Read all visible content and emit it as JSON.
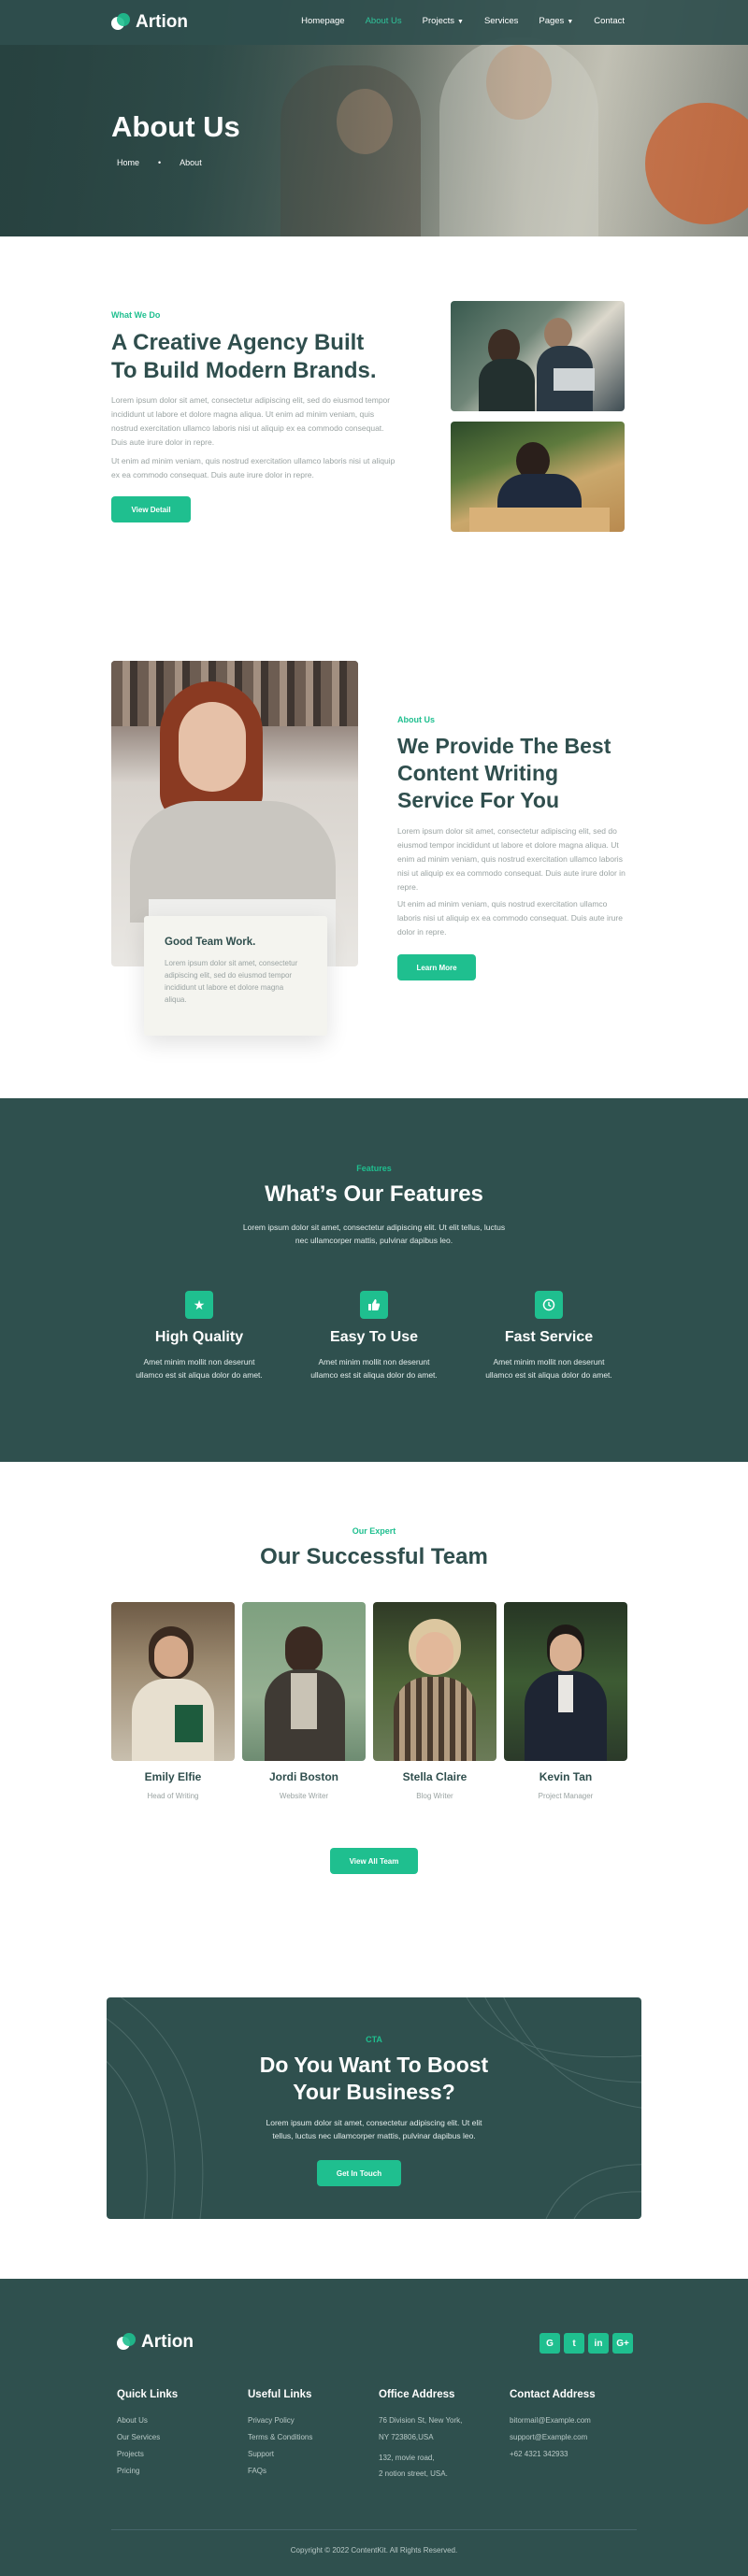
{
  "brand": {
    "name": "Artion"
  },
  "nav": {
    "items": [
      {
        "label": "Homepage"
      },
      {
        "label": "About Us"
      },
      {
        "label": "Projects"
      },
      {
        "label": "Services"
      },
      {
        "label": "Pages"
      },
      {
        "label": "Contact"
      }
    ]
  },
  "hero": {
    "title": "About Us",
    "crumb_home": "Home",
    "crumb_sep": "•",
    "crumb_current": "About"
  },
  "whatwedo": {
    "eyebrow": "What We Do",
    "title_line1": "A Creative Agency Built",
    "title_line2": "To Build Modern Brands.",
    "para1": "Lorem ipsum dolor sit amet, consectetur adipiscing elit, sed do eiusmod tempor incididunt ut labore et dolore magna aliqua. Ut enim ad minim veniam, quis nostrud exercitation ullamco laboris nisi ut aliquip ex ea commodo consequat. Duis aute irure dolor in repre.",
    "para2": "Ut enim ad minim veniam, quis nostrud exercitation ullamco laboris nisi ut aliquip ex ea commodo consequat. Duis aute irure dolor in repre.",
    "button": "View Detail"
  },
  "aboutus": {
    "eyebrow": "About Us",
    "title_line1": "We Provide The Best",
    "title_line2": "Content Writing",
    "title_line3": "Service For You",
    "para1": "Lorem ipsum dolor sit amet, consectetur adipiscing elit, sed do eiusmod tempor incididunt ut labore et dolore magna aliqua. Ut enim ad minim veniam, quis nostrud exercitation ullamco laboris nisi ut aliquip ex ea commodo consequat. Duis aute irure dolor in repre.",
    "para2": "Ut enim ad minim veniam, quis nostrud exercitation ullamco laboris nisi ut aliquip ex ea commodo consequat. Duis aute irure dolor in repre.",
    "button": "Learn More",
    "card_title": "Good Team Work.",
    "card_text": "Lorem ipsum dolor sit amet, consectetur adipiscing elit, sed do eiusmod tempor incididunt ut labore et dolore magna aliqua."
  },
  "features": {
    "eyebrow": "Features",
    "title": "What’s Our Features",
    "subtitle_line1": "Lorem ipsum dolor sit amet, consectetur adipiscing elit. Ut elit tellus, luctus",
    "subtitle_line2": "nec ullamcorper mattis, pulvinar dapibus leo.",
    "items": [
      {
        "icon": "star-icon",
        "title": "High Quality",
        "line1": "Amet minim mollit non deserunt",
        "line2": "ullamco est sit aliqua dolor do amet."
      },
      {
        "icon": "thumbs-up-icon",
        "title": "Easy To Use",
        "line1": "Amet minim mollit non deserunt",
        "line2": "ullamco est sit aliqua dolor do amet."
      },
      {
        "icon": "clock-icon",
        "title": "Fast Service",
        "line1": "Amet minim mollit non deserunt",
        "line2": "ullamco est sit aliqua dolor do amet."
      }
    ]
  },
  "team": {
    "eyebrow": "Our Expert",
    "title": "Our Successful Team",
    "members": [
      {
        "name": "Emily Elfie",
        "role": "Head of Writing"
      },
      {
        "name": "Jordi Boston",
        "role": "Website Writer"
      },
      {
        "name": "Stella Claire",
        "role": "Blog Writer"
      },
      {
        "name": "Kevin Tan",
        "role": "Project Manager"
      }
    ],
    "button": "View All Team"
  },
  "cta": {
    "eyebrow": "CTA",
    "title_line1": "Do You Want To Boost",
    "title_line2": "Your Business?",
    "text_line1": "Lorem ipsum dolor sit amet, consectetur adipiscing elit. Ut elit",
    "text_line2": "tellus, luctus nec ullamcorper mattis, pulvinar dapibus leo.",
    "button": "Get In Touch"
  },
  "footer": {
    "brand": "Artion",
    "social": [
      "G",
      "t",
      "in",
      "G+"
    ],
    "quick_links": {
      "title": "Quick Links",
      "items": [
        "About Us",
        "Our Services",
        "Projects",
        "Pricing"
      ]
    },
    "useful_links": {
      "title": "Useful Links",
      "items": [
        "Privacy Policy",
        "Terms & Conditions",
        "Support",
        "FAQs"
      ]
    },
    "office": {
      "title": "Office Address",
      "lines": [
        "76 Division St, New York,",
        "NY 723806,USA",
        "132, movie road,",
        "2 notion street, USA."
      ]
    },
    "contact": {
      "title": "Contact Address",
      "lines": [
        "bitormail@Example.com",
        "support@Example.com",
        "+62 4321 342933"
      ]
    },
    "copyright": "Copyright © 2022 ContentKit. All Rights Reserved."
  },
  "colors": {
    "primary": "#2f504e",
    "accent": "#1fbf8f"
  }
}
